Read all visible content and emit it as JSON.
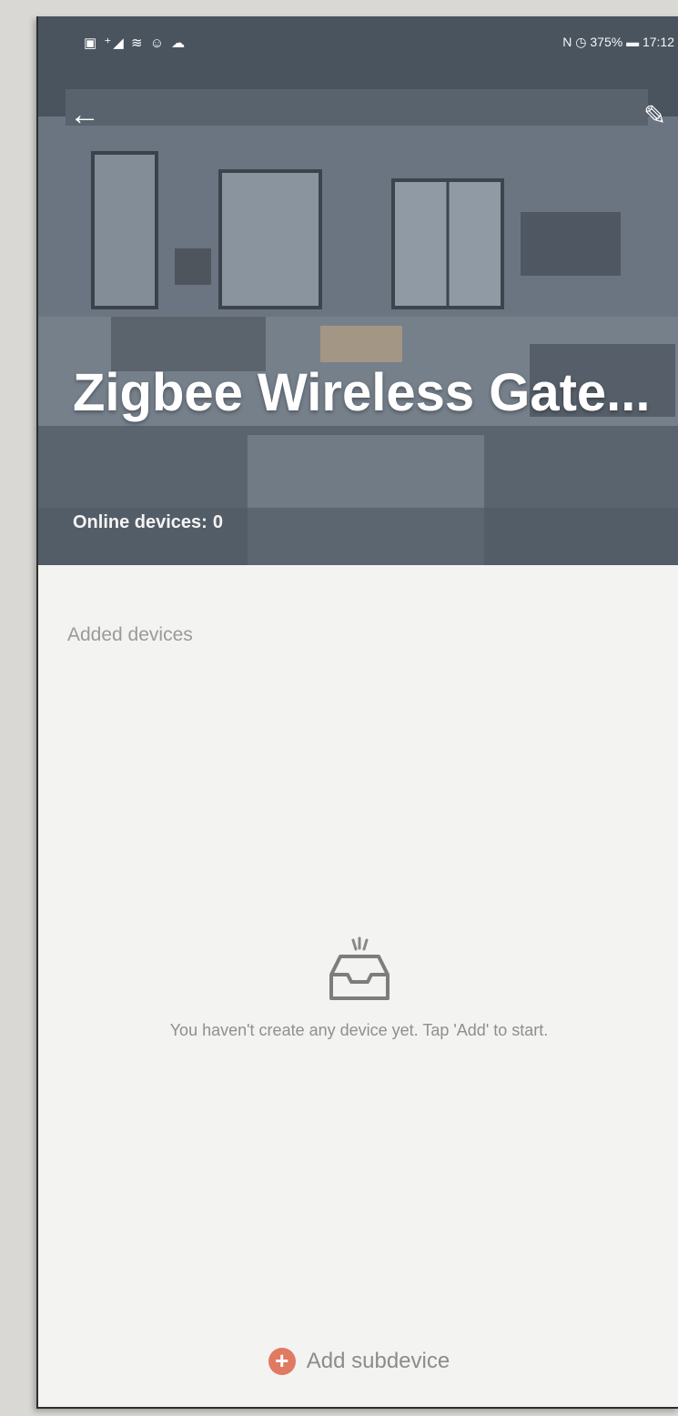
{
  "status_bar": {
    "left_icons": "▣ ⁺◢ ≋ ☺ ☁",
    "right_text": "N ◷ 375% ▬ 17:12"
  },
  "header": {
    "back_icon": "arrow-left-icon",
    "edit_icon": "pencil-icon",
    "title": "Zigbee Wireless Gate...",
    "online_label": "Online devices:",
    "online_count": "0"
  },
  "main": {
    "section_label": "Added devices",
    "empty_message": "You haven't create any device yet. Tap 'Add' to start."
  },
  "footer": {
    "add_label": "Add subdevice",
    "add_icon": "plus-circle-icon"
  },
  "colors": {
    "accent": "#e07a63",
    "background": "#f3f3f1",
    "muted_text": "#9a9a9a"
  }
}
